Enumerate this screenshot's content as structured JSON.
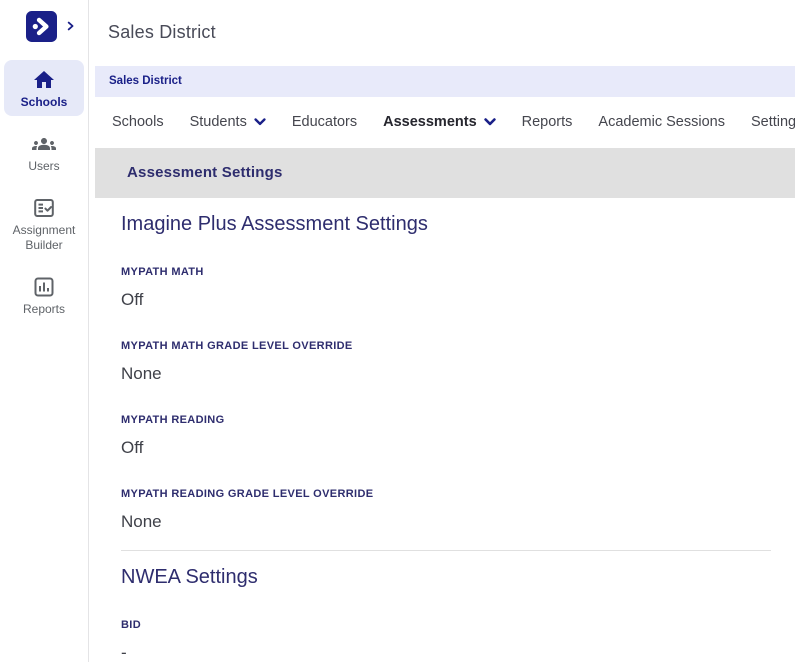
{
  "colors": {
    "brand_navy": "#1a2088",
    "heading_navy": "#2e2d6e",
    "breadcrumb_bg": "#e8eafa",
    "active_item_bg": "#e6e9f8",
    "section_bar_bg": "#e0e0e0",
    "inactive_gray": "#5f6368"
  },
  "header": {
    "title": "Sales District"
  },
  "breadcrumb": {
    "label": "Sales District"
  },
  "sidebar": {
    "items": [
      {
        "label": "Schools",
        "icon": "home-icon",
        "active": true
      },
      {
        "label": "Users",
        "icon": "groups-icon",
        "active": false
      },
      {
        "label": "Assignment Builder",
        "icon": "assignment-builder-icon",
        "active": false
      },
      {
        "label": "Reports",
        "icon": "reports-icon",
        "active": false
      }
    ]
  },
  "tabs": [
    {
      "label": "Schools",
      "dropdown": false,
      "active": false
    },
    {
      "label": "Students",
      "dropdown": true,
      "active": false
    },
    {
      "label": "Educators",
      "dropdown": false,
      "active": false
    },
    {
      "label": "Assessments",
      "dropdown": true,
      "active": true
    },
    {
      "label": "Reports",
      "dropdown": false,
      "active": false
    },
    {
      "label": "Academic Sessions",
      "dropdown": false,
      "active": false
    },
    {
      "label": "Settings",
      "dropdown": false,
      "active": false
    }
  ],
  "section_bar": {
    "title": "Assessment Settings"
  },
  "main": {
    "sections": [
      {
        "heading": "Imagine Plus Assessment Settings",
        "fields": [
          {
            "label": "MYPATH MATH",
            "value": "Off"
          },
          {
            "label": "MYPATH MATH GRADE LEVEL OVERRIDE",
            "value": "None"
          },
          {
            "label": "MYPATH READING",
            "value": "Off"
          },
          {
            "label": "MYPATH READING GRADE LEVEL OVERRIDE",
            "value": "None"
          }
        ]
      },
      {
        "heading": "NWEA Settings",
        "fields": [
          {
            "label": "BID",
            "value": "-"
          }
        ]
      }
    ]
  }
}
